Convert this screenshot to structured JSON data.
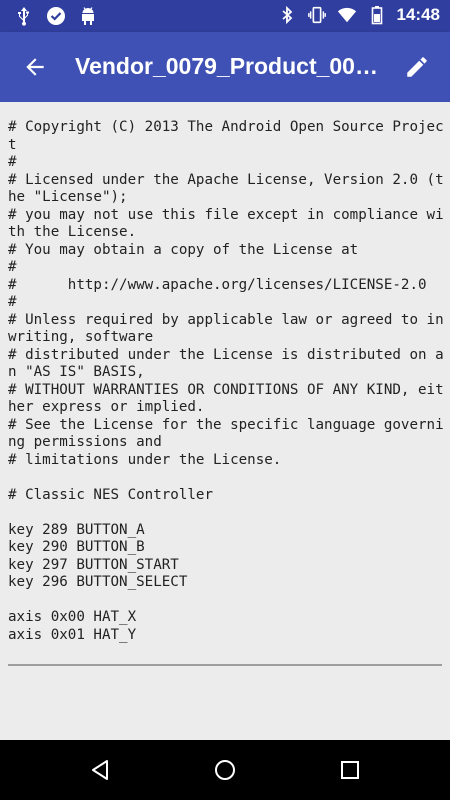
{
  "status_bar": {
    "time": "14:48",
    "left_icons": [
      "usb-icon",
      "check-badge-icon",
      "android-icon"
    ],
    "right_icons": [
      "bluetooth-icon",
      "vibrate-icon",
      "wifi-icon",
      "battery-icon"
    ]
  },
  "app_bar": {
    "title": "Vendor_0079_Product_00…",
    "back_icon": "arrow-back-icon",
    "edit_icon": "pencil-icon",
    "color": "#3f51b5"
  },
  "file": {
    "content": "# Copyright (C) 2013 The Android Open Source Project\n#\n# Licensed under the Apache License, Version 2.0 (the \"License\");\n# you may not use this file except in compliance with the License.\n# You may obtain a copy of the License at\n#\n#      http://www.apache.org/licenses/LICENSE-2.0\n#\n# Unless required by applicable law or agreed to in writing, software\n# distributed under the License is distributed on an \"AS IS\" BASIS,\n# WITHOUT WARRANTIES OR CONDITIONS OF ANY KIND, either express or implied.\n# See the License for the specific language governing permissions and\n# limitations under the License.\n\n# Classic NES Controller\n\nkey 289 BUTTON_A\nkey 290 BUTTON_B\nkey 297 BUTTON_START\nkey 296 BUTTON_SELECT\n\naxis 0x00 HAT_X\naxis 0x01 HAT_Y"
  },
  "nav_bar": {
    "buttons": [
      "back-triangle-icon",
      "home-circle-icon",
      "recents-square-icon"
    ]
  }
}
